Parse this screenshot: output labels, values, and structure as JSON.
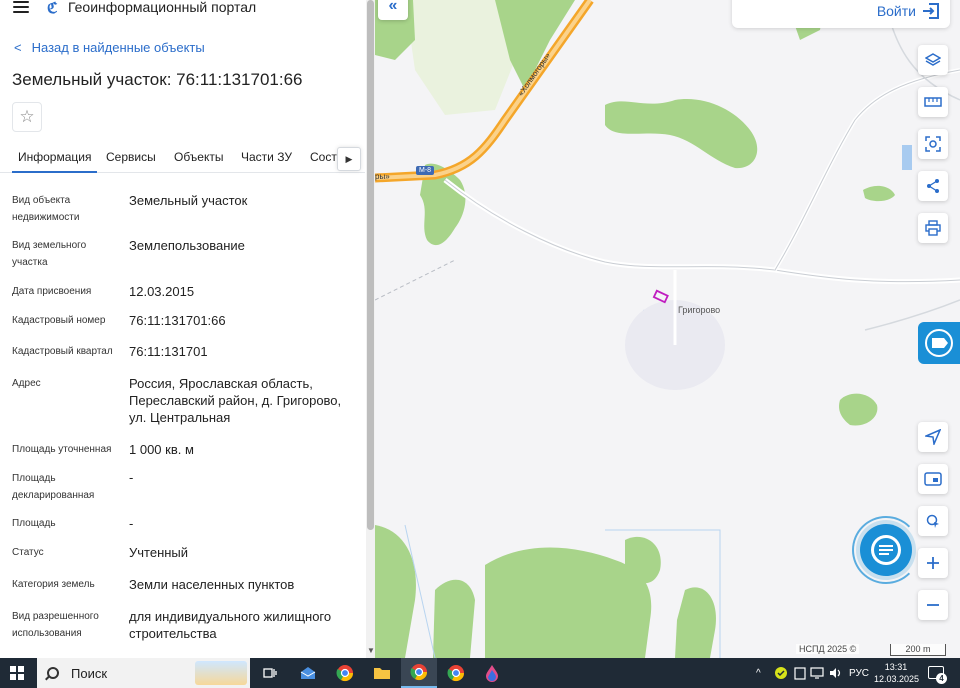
{
  "app": {
    "title": "Геоинформационный портал",
    "logo_glyph": "ℭ"
  },
  "panel": {
    "back_label": "Назад в найденные объекты",
    "title": "Земельный участок: 76:11:131701:66",
    "tabs": [
      {
        "label": "Информация"
      },
      {
        "label": "Сервисы"
      },
      {
        "label": "Объекты"
      },
      {
        "label": "Части ЗУ"
      },
      {
        "label": "Состав"
      }
    ],
    "properties": [
      {
        "label": "Вид объекта недвижимости",
        "value": "Земельный участок"
      },
      {
        "label": "Вид земельного участка",
        "value": "Землепользование"
      },
      {
        "label": "Дата присвоения",
        "value": "12.03.2015"
      },
      {
        "label": "Кадастровый номер",
        "value": "76:11:131701:66"
      },
      {
        "label": "Кадастровый квартал",
        "value": "76:11:131701"
      },
      {
        "label": "Адрес",
        "value": "Россия, Ярославская область, Переславский район, д. Григорово, ул. Центральная"
      },
      {
        "label": "Площадь уточненная",
        "value": "1 000 кв. м"
      },
      {
        "label": "Площадь декларированная",
        "value": "-"
      },
      {
        "label": "Площадь",
        "value": "-"
      },
      {
        "label": "Статус",
        "value": "Учтенный"
      },
      {
        "label": "Категория земель",
        "value": "Земли населенных пунктов"
      },
      {
        "label": "Вид разрешенного использования",
        "value": "для индивидуального жилищного строительства"
      }
    ]
  },
  "map": {
    "login_label": "Войти",
    "village_label": "Григорово",
    "road_label": "«Холмогоры»",
    "road_label_cut": "ры»",
    "road_shield": "М-8",
    "corner_label": "Б",
    "attribution": "НСПД 2025 ©",
    "scale_label": "200 m",
    "colors": {
      "road": "#f4a62a",
      "forest": "#a8d48a",
      "accent": "#2b6dca",
      "parcel": "#c01ec0"
    }
  },
  "taskbar": {
    "search_label": "Поиск",
    "lang": "РУС",
    "time": "13:31",
    "date": "12.03.2025",
    "notifications": "4"
  }
}
